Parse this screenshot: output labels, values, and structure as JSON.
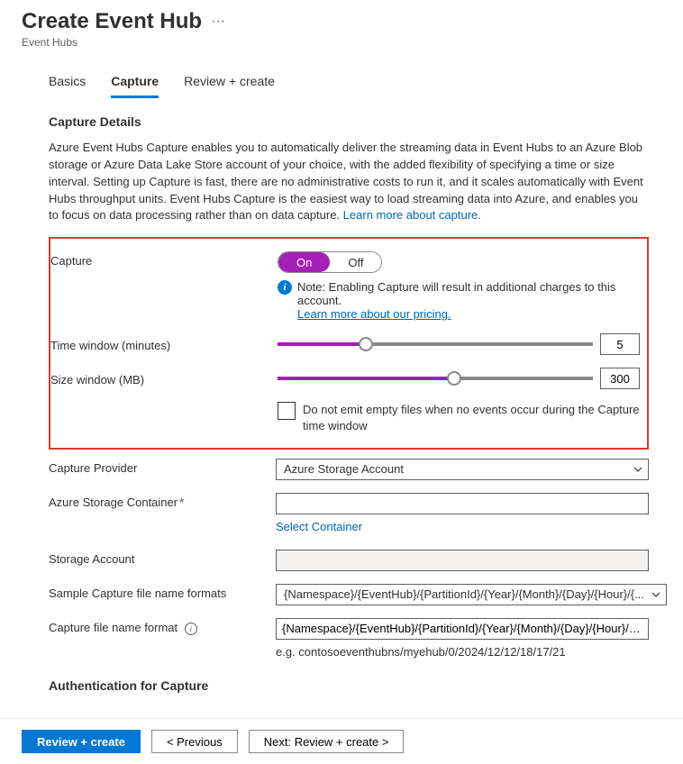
{
  "header": {
    "title": "Create Event Hub",
    "breadcrumb": "Event Hubs"
  },
  "tabs": [
    {
      "label": "Basics",
      "active": false
    },
    {
      "label": "Capture",
      "active": true
    },
    {
      "label": "Review + create",
      "active": false
    }
  ],
  "section": {
    "heading": "Capture Details",
    "description": "Azure Event Hubs Capture enables you to automatically deliver the streaming data in Event Hubs to an Azure Blob storage or Azure Data Lake Store account of your choice, with the added flexibility of specifying a time or size interval. Setting up Capture is fast, there are no administrative costs to run it, and it scales automatically with Event Hubs throughput units. Event Hubs Capture is the easiest way to load streaming data into Azure, and enables you to focus on data processing rather than on data capture. ",
    "learn_more": "Learn more about capture."
  },
  "capture": {
    "label": "Capture",
    "toggle_on": "On",
    "toggle_off": "Off",
    "state": "On",
    "note": "Note: Enabling Capture will result in additional charges to this account. ",
    "pricing_link": "Learn more about our pricing."
  },
  "time_window": {
    "label": "Time window (minutes)",
    "value": "5",
    "percent": 28
  },
  "size_window": {
    "label": "Size window (MB)",
    "value": "300",
    "percent": 56
  },
  "empty_files": {
    "label": "Do not emit empty files when no events occur during the Capture time window"
  },
  "provider": {
    "label": "Capture Provider",
    "value": "Azure Storage Account"
  },
  "container": {
    "label": "Azure Storage Container",
    "value": "",
    "select_link": "Select Container"
  },
  "storage_account": {
    "label": "Storage Account",
    "value": ""
  },
  "sample_format": {
    "label": "Sample Capture file name formats",
    "value": "{Namespace}/{EventHub}/{PartitionId}/{Year}/{Month}/{Day}/{Hour}/{..."
  },
  "file_format": {
    "label": "Capture file name format",
    "value": "{Namespace}/{EventHub}/{PartitionId}/{Year}/{Month}/{Day}/{Hour}/{Min...",
    "example": "e.g. contosoeventhubns/myehub/0/2024/12/12/18/17/21"
  },
  "auth": {
    "heading": "Authentication for Capture"
  },
  "footer": {
    "review": "Review + create",
    "previous": "< Previous",
    "next": "Next: Review + create >"
  }
}
